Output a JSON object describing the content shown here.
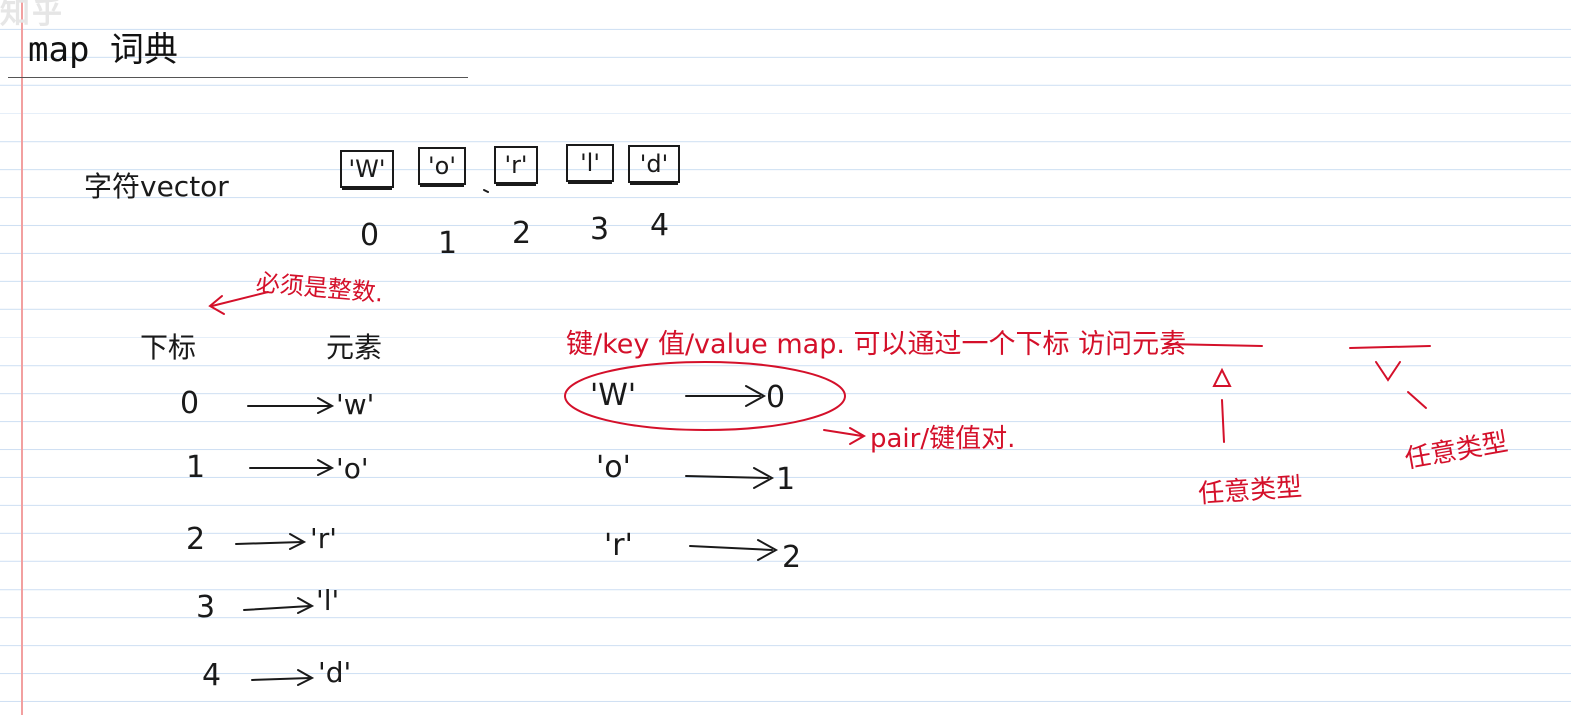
{
  "watermark": "知乎",
  "title": "map 词典",
  "vector_label": "字符vector",
  "vector_cells": [
    "'W'",
    "'o'",
    "'r'",
    "'l'",
    "'d'"
  ],
  "vector_indices": [
    "0",
    "1",
    "2",
    "3",
    "4"
  ],
  "index_note": "必须是整数.",
  "header_index": "下标",
  "header_element": "元素",
  "index_rows": [
    {
      "idx": "0",
      "val": "'w'"
    },
    {
      "idx": "1",
      "val": "'o'"
    },
    {
      "idx": "2",
      "val": "'r'"
    },
    {
      "idx": "3",
      "val": "'l'"
    },
    {
      "idx": "4",
      "val": "'d'"
    }
  ],
  "map_header": "键/key  值/value map.  可以通过一个下标 访问元素",
  "map_rows": [
    {
      "key": "'W'",
      "val": "0"
    },
    {
      "key": "'o'",
      "val": "1"
    },
    {
      "key": "'r'",
      "val": "2"
    }
  ],
  "pair_note": "pair/键值对.",
  "any_type_1": "任意类型",
  "any_type_2": "任意类型",
  "colors": {
    "ink_black": "#1a1a1a",
    "ink_red": "#d4102a",
    "rule_blue": "#cfe0f3",
    "margin_red": "#f2a0a0"
  }
}
